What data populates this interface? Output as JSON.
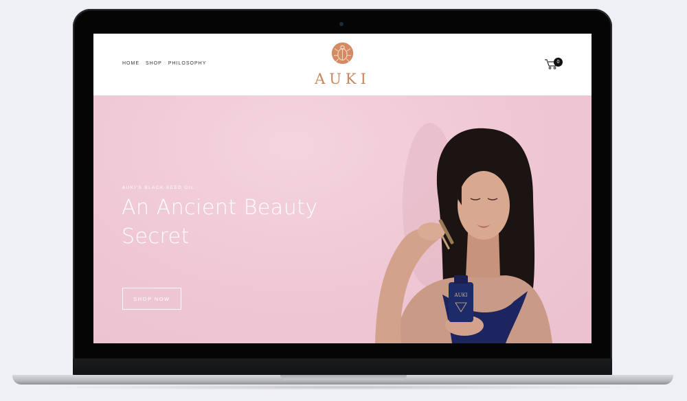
{
  "header": {
    "nav": [
      "HOME",
      "SHOP",
      "PHILOSOPHY"
    ],
    "logo_text": "AUKI",
    "cart_count": "0"
  },
  "hero": {
    "eyebrow": "AUKI'S BLACK SEED OIL",
    "headline": "An Ancient Beauty Secret",
    "cta_label": "SHOP NOW",
    "bottle_label": "AUKI"
  },
  "colors": {
    "brand": "#c9865e",
    "hero_bg": "#efc7d4",
    "header_bg": "#ffffff"
  }
}
